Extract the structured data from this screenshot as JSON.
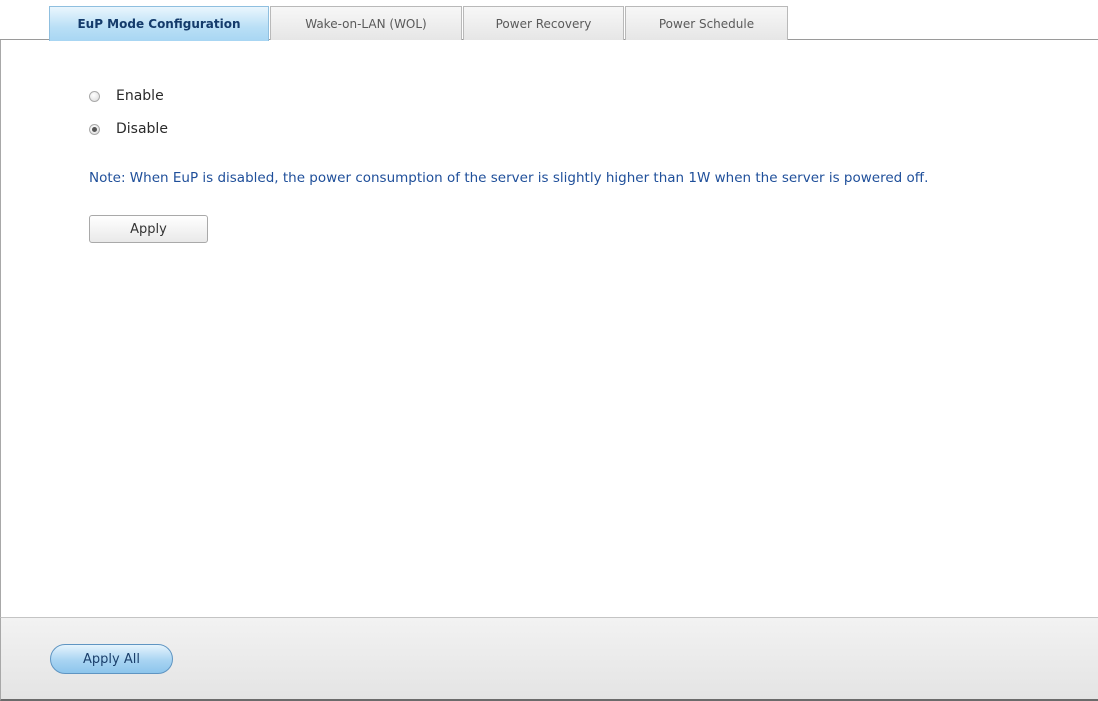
{
  "tabs": [
    {
      "label": "EuP Mode Configuration",
      "active": true
    },
    {
      "label": "Wake-on-LAN (WOL)",
      "active": false
    },
    {
      "label": "Power Recovery",
      "active": false
    },
    {
      "label": "Power Schedule",
      "active": false
    }
  ],
  "eup": {
    "options": [
      {
        "label": "Enable",
        "checked": false
      },
      {
        "label": "Disable",
        "checked": true
      }
    ],
    "note": "Note: When EuP is disabled, the power consumption of the server is slightly higher than 1W when the server is powered off.",
    "apply_label": "Apply"
  },
  "footer": {
    "apply_all_label": "Apply All"
  },
  "colors": {
    "note_text": "#1f4f9a",
    "active_tab": "#b9dff6",
    "apply_all_button": "#a8d4f2"
  }
}
